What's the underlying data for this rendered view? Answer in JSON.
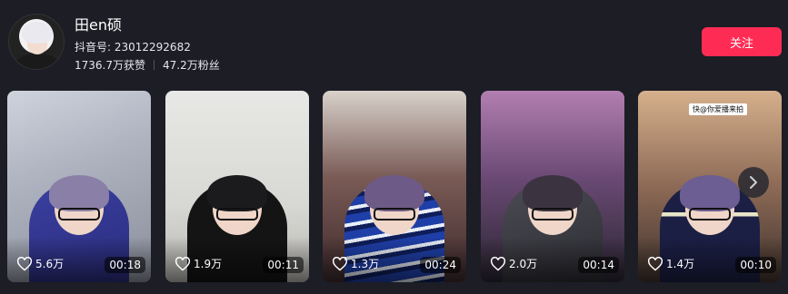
{
  "profile": {
    "name": "田en硕",
    "douyin_id": "抖音号: 23012292682",
    "likes_total": "1736.7万获赞",
    "followers": "47.2万粉丝",
    "follow_label": "关注"
  },
  "colors": {
    "background": "#1c1d25",
    "follow_button": "#fe2c55"
  },
  "videos": [
    {
      "likes": "5.6万",
      "duration": "00:18"
    },
    {
      "likes": "1.9万",
      "duration": "00:11"
    },
    {
      "likes": "1.3万",
      "duration": "00:24"
    },
    {
      "likes": "2.0万",
      "duration": "00:14"
    },
    {
      "likes": "1.4万",
      "duration": "00:10",
      "sticker": "快@你爱播来拍"
    }
  ],
  "icons": {
    "like": "heart-outline-icon",
    "next": "chevron-right-icon"
  }
}
